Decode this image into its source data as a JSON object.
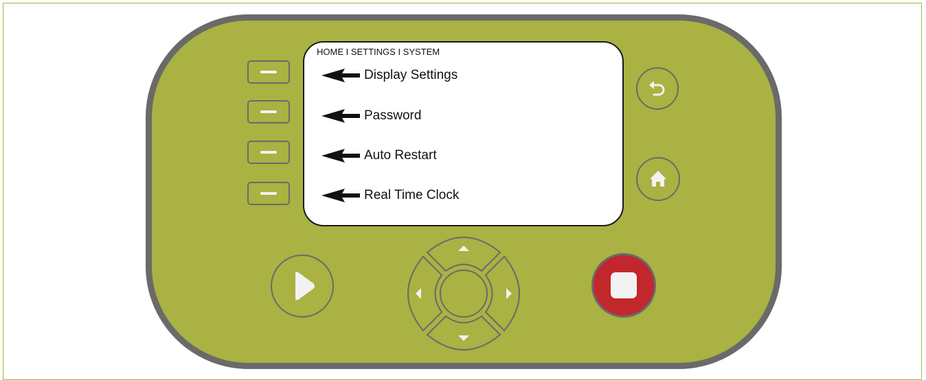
{
  "screen": {
    "breadcrumb": "HOME I SETTINGS I SYSTEM",
    "menu_items": [
      {
        "label": "Display Settings",
        "icon": "arrow-left-icon"
      },
      {
        "label": "Password",
        "icon": "arrow-left-icon"
      },
      {
        "label": "Auto Restart",
        "icon": "arrow-left-icon"
      },
      {
        "label": "Real Time Clock",
        "icon": "arrow-left-icon"
      }
    ]
  },
  "controls": {
    "soft_keys": [
      "soft-key-1",
      "soft-key-2",
      "soft-key-3",
      "soft-key-4"
    ],
    "back_icon": "back-arrow-icon",
    "home_icon": "home-icon",
    "play_icon": "play-icon",
    "stop_icon": "stop-icon",
    "dpad": [
      "up",
      "down",
      "left",
      "right",
      "center"
    ]
  },
  "colors": {
    "body": "#a9b242",
    "bezel": "#6a6a6a",
    "stop_button": "#c1272d",
    "screen": "#ffffff"
  }
}
